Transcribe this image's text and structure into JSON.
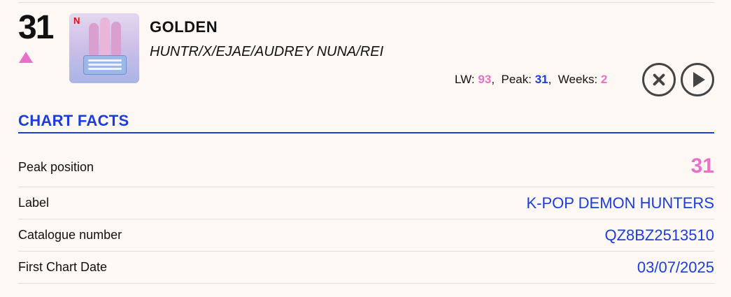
{
  "entry": {
    "position": "31",
    "trend": "up",
    "trend_icon": "triangle-up-icon",
    "title": "GOLDEN",
    "artist": "HUNTR/X/EJAE/AUDREY NUNA/REI",
    "artwork": {
      "badge": "N",
      "description_icon": "album-artwork"
    }
  },
  "stats": {
    "lw_label": "LW:",
    "lw_value": "93",
    "peak_label": "Peak:",
    "peak_value": "31",
    "weeks_label": "Weeks:",
    "weeks_value": "2"
  },
  "controls": {
    "close_icon": "close-icon",
    "play_icon": "play-icon"
  },
  "chart_facts": {
    "heading": "CHART FACTS",
    "rows": [
      {
        "label": "Peak position",
        "value": "31"
      },
      {
        "label": "Label",
        "value": "K-POP DEMON HUNTERS"
      },
      {
        "label": "Catalogue number",
        "value": "QZ8BZ2513510"
      },
      {
        "label": "First Chart Date",
        "value": "03/07/2025"
      }
    ]
  },
  "colors": {
    "accent_blue": "#1a3ce0",
    "accent_pink": "#e870c9",
    "background": "#fdf8f4"
  }
}
